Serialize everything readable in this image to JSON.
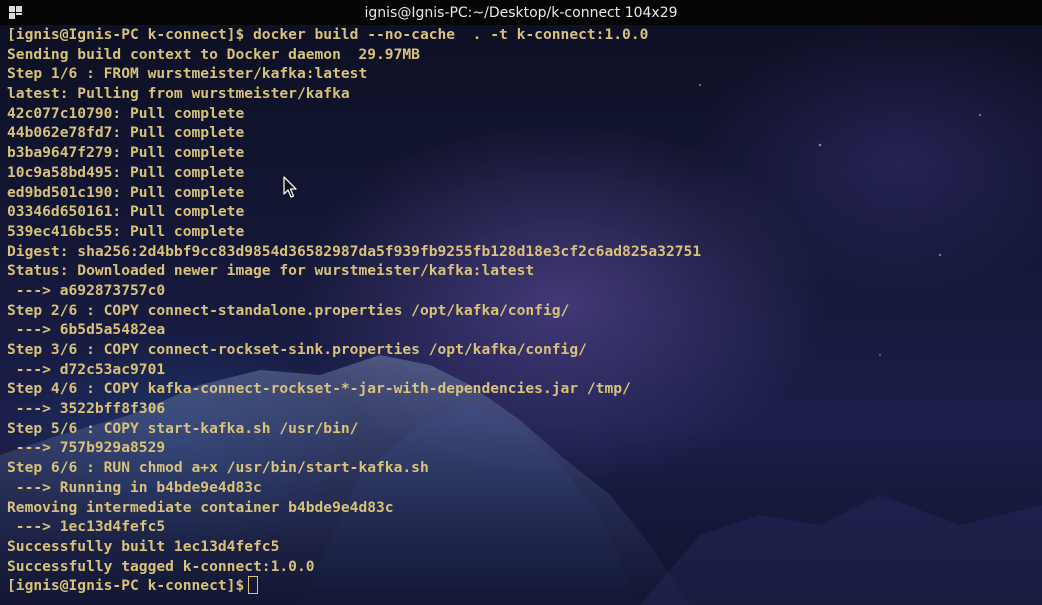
{
  "window": {
    "title": "ignis@Ignis-PC:~/Desktop/k-connect 104x29"
  },
  "terminal": {
    "lines": [
      "[ignis@Ignis-PC k-connect]$ docker build --no-cache  . -t k-connect:1.0.0",
      "Sending build context to Docker daemon  29.97MB",
      "Step 1/6 : FROM wurstmeister/kafka:latest",
      "latest: Pulling from wurstmeister/kafka",
      "42c077c10790: Pull complete",
      "44b062e78fd7: Pull complete",
      "b3ba9647f279: Pull complete",
      "10c9a58bd495: Pull complete",
      "ed9bd501c190: Pull complete",
      "03346d650161: Pull complete",
      "539ec416bc55: Pull complete",
      "Digest: sha256:2d4bbf9cc83d9854d36582987da5f939fb9255fb128d18e3cf2c6ad825a32751",
      "Status: Downloaded newer image for wurstmeister/kafka:latest",
      " ---> a692873757c0",
      "Step 2/6 : COPY connect-standalone.properties /opt/kafka/config/",
      " ---> 6b5d5a5482ea",
      "Step 3/6 : COPY connect-rockset-sink.properties /opt/kafka/config/",
      " ---> d72c53ac9701",
      "Step 4/6 : COPY kafka-connect-rockset-*-jar-with-dependencies.jar /tmp/",
      " ---> 3522bff8f306",
      "Step 5/6 : COPY start-kafka.sh /usr/bin/",
      " ---> 757b929a8529",
      "Step 6/6 : RUN chmod a+x /usr/bin/start-kafka.sh",
      " ---> Running in b4bde9e4d83c",
      "Removing intermediate container b4bde9e4d83c",
      " ---> 1ec13d4fefc5",
      "Successfully built 1ec13d4fefc5",
      "Successfully tagged k-connect:1.0.0"
    ],
    "prompt": "[ignis@Ignis-PC k-connect]$"
  },
  "icons": {
    "window_menu": "window-menu-icon",
    "cursor": "text-cursor",
    "pointer": "mouse-pointer-icon"
  },
  "colors": {
    "terminal_text": "#d8c27a",
    "titlebar_bg": "#050505",
    "titlebar_text": "#e8e8e8"
  }
}
